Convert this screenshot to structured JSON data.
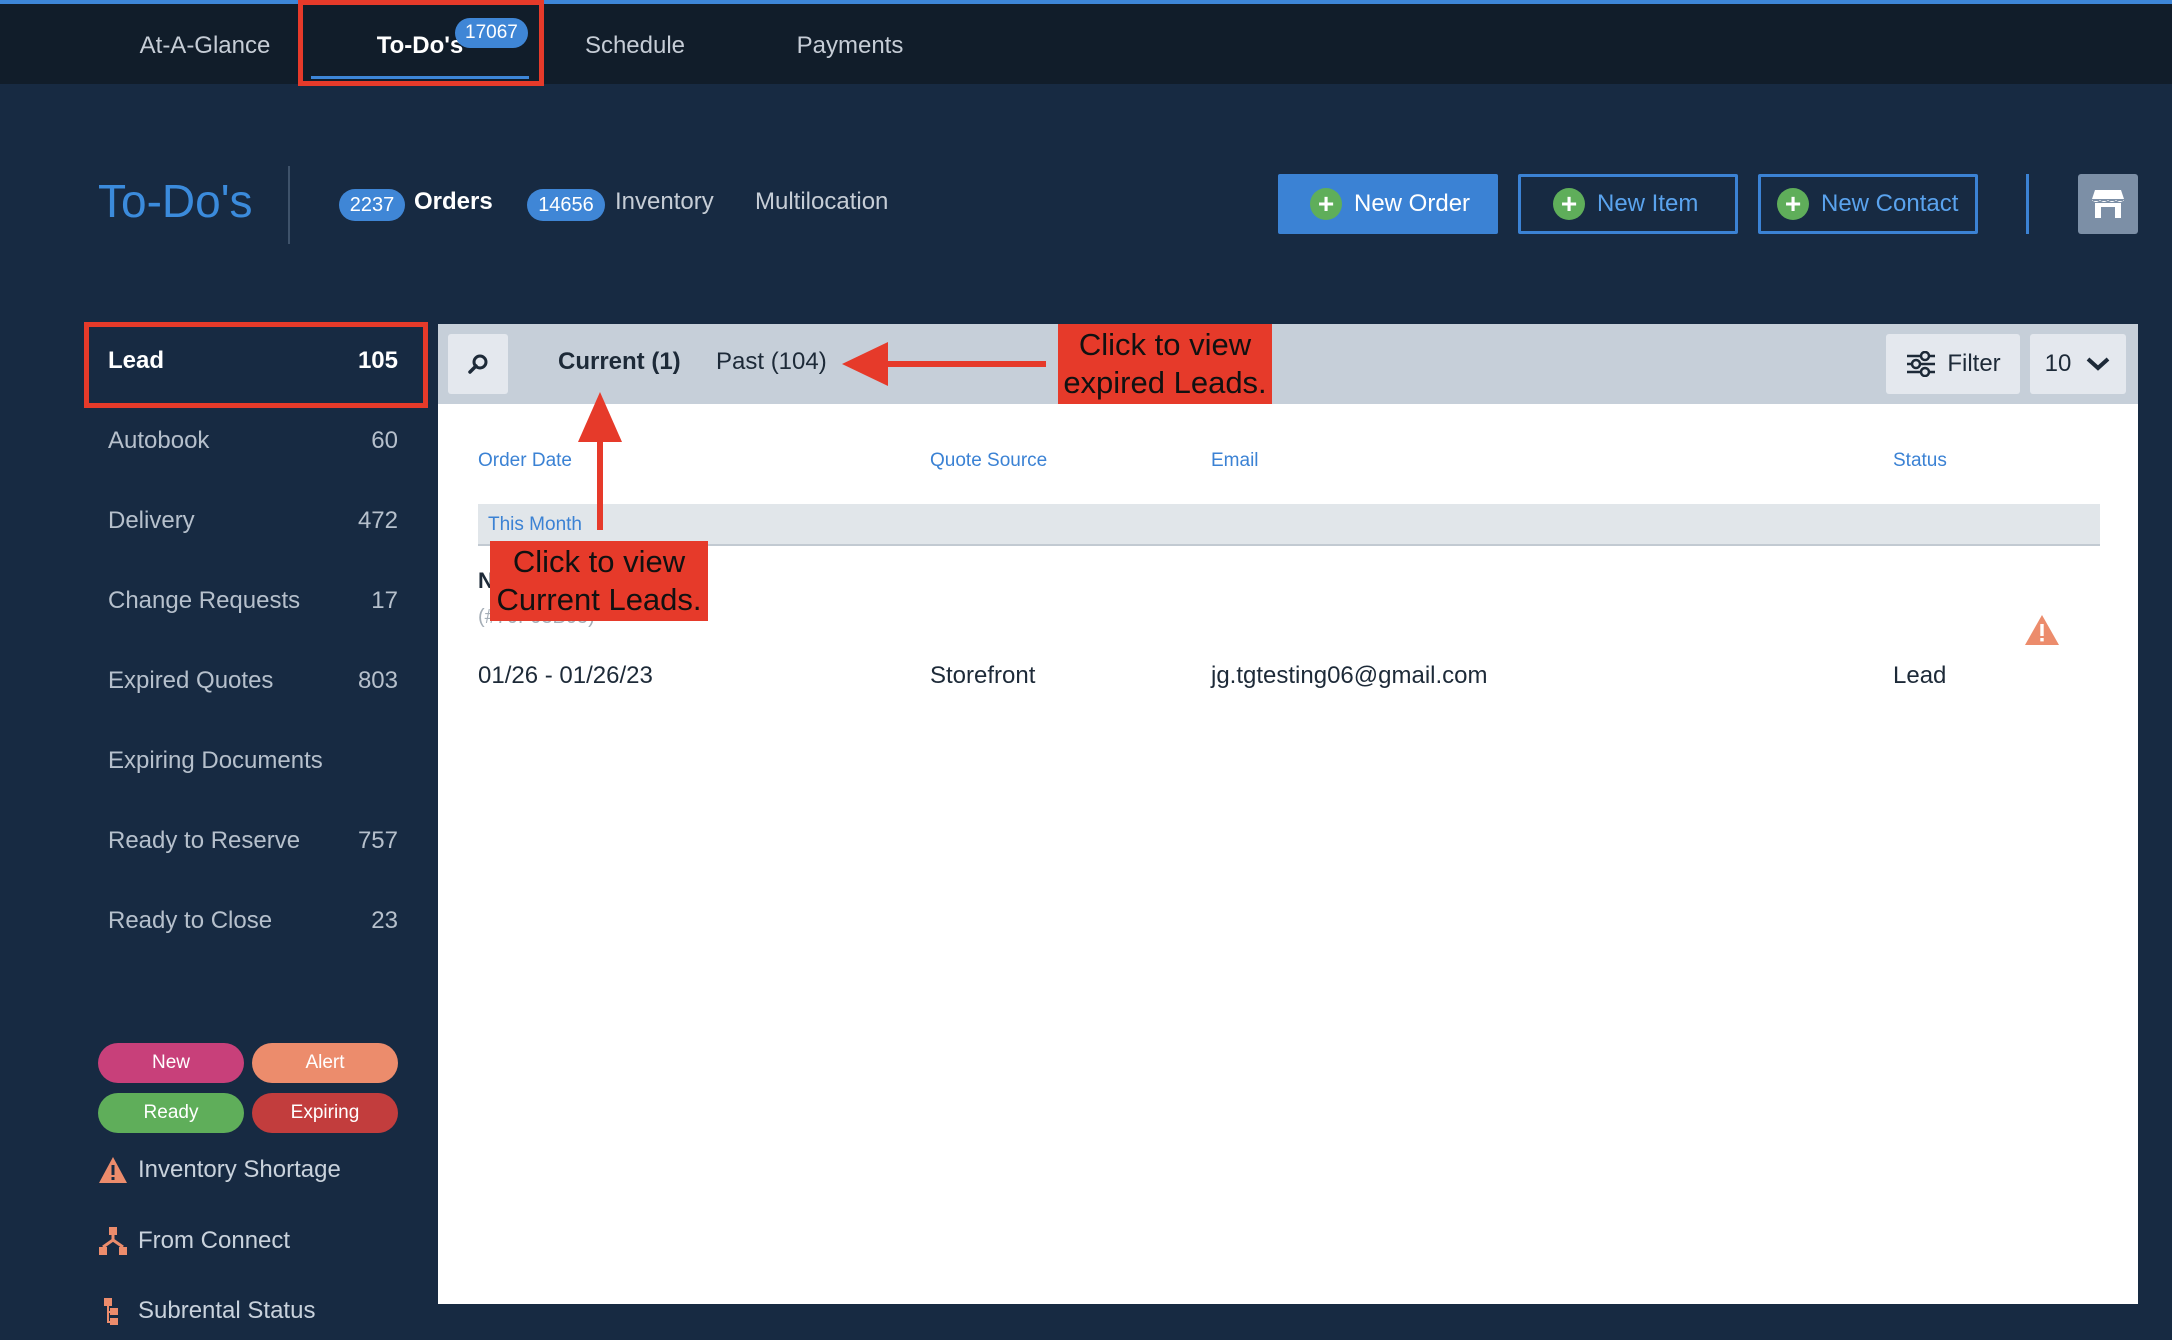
{
  "top_nav": {
    "items": [
      "At-A-Glance",
      "To-Do's",
      "Schedule",
      "Payments"
    ],
    "todos_badge": "17067"
  },
  "header": {
    "title": "To-Do's",
    "orders_count": "2237",
    "orders_label": "Orders",
    "inventory_count": "14656",
    "inventory_label": "Inventory",
    "multilocation_label": "Multilocation",
    "new_order": "New Order",
    "new_item": "New Item",
    "new_contact": "New Contact",
    "store_icon": "store-icon"
  },
  "sidebar": {
    "items": [
      {
        "label": "Lead",
        "count": "105"
      },
      {
        "label": "Autobook",
        "count": "60"
      },
      {
        "label": "Delivery",
        "count": "472"
      },
      {
        "label": "Change Requests",
        "count": "17"
      },
      {
        "label": "Expired Quotes",
        "count": "803"
      },
      {
        "label": "Expiring Documents",
        "count": ""
      },
      {
        "label": "Ready to Reserve",
        "count": "757"
      },
      {
        "label": "Ready to Close",
        "count": "23"
      }
    ],
    "legend": {
      "new": "New",
      "alert": "Alert",
      "ready": "Ready",
      "expiring": "Expiring",
      "colors": {
        "new": "#c8407a",
        "alert": "#ec8c6c",
        "ready": "#5fae5a",
        "expiring": "#c23d3d"
      }
    },
    "extras": {
      "inventory_shortage": "Inventory Shortage",
      "from_connect": "From Connect",
      "subrental_status": "Subrental Status"
    }
  },
  "panel": {
    "tabs": {
      "current": "Current (1)",
      "past": "Past (104)"
    },
    "filter_label": "Filter",
    "per_page": "10",
    "columns": {
      "order_date": "Order Date",
      "quote_source": "Quote Source",
      "email": "Email",
      "status": "Status"
    },
    "group_label": "This Month",
    "row": {
      "name": "N",
      "sub": "(#70F03B05)",
      "order_date": "01/26 - 01/26/23",
      "quote_source": "Storefront",
      "email": "jg.tgtesting06@gmail.com",
      "status": "Lead"
    }
  },
  "annotations": {
    "expired_line1": "Click to view",
    "expired_line2": "expired Leads.",
    "current_line1": "Click to view",
    "current_line2": "Current Leads."
  },
  "colors": {
    "accent": "#3b82d4",
    "annotation": "#e63a2a",
    "background": "#172a42"
  }
}
